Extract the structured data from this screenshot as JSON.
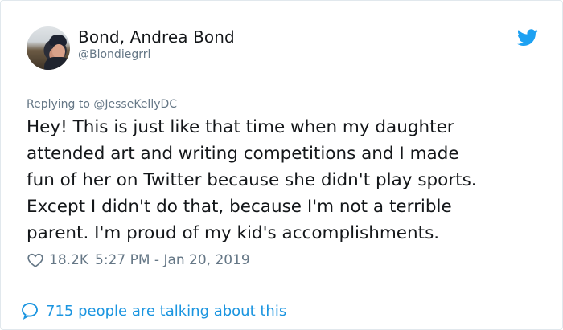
{
  "author": {
    "display_name": "Bond, Andrea Bond",
    "handle": "@Blondiegrrl"
  },
  "reply": {
    "prefix": "Replying to ",
    "to_handle": "@JesseKellyDC"
  },
  "tweet": {
    "text": "Hey! This is just like that time when my daughter\nattended art and writing competitions and I made\nfun of her on Twitter because she didn't play sports.\nExcept I didn't do that, because I'm not a terrible\nparent. I'm proud of my kid's accomplishments."
  },
  "meta": {
    "likes": "18.2K",
    "timestamp": "5:27 PM - Jan 20, 2019"
  },
  "footer": {
    "talking_text": "715 people are talking about this"
  },
  "icons": {
    "brand": "twitter-bird-icon",
    "like": "heart-icon",
    "conversation": "speech-bubble-icon"
  },
  "colors": {
    "brand_blue": "#1da1f2",
    "link_blue": "#1b95e0",
    "text": "#14171a",
    "muted": "#657786",
    "border": "#e1e8ed"
  }
}
